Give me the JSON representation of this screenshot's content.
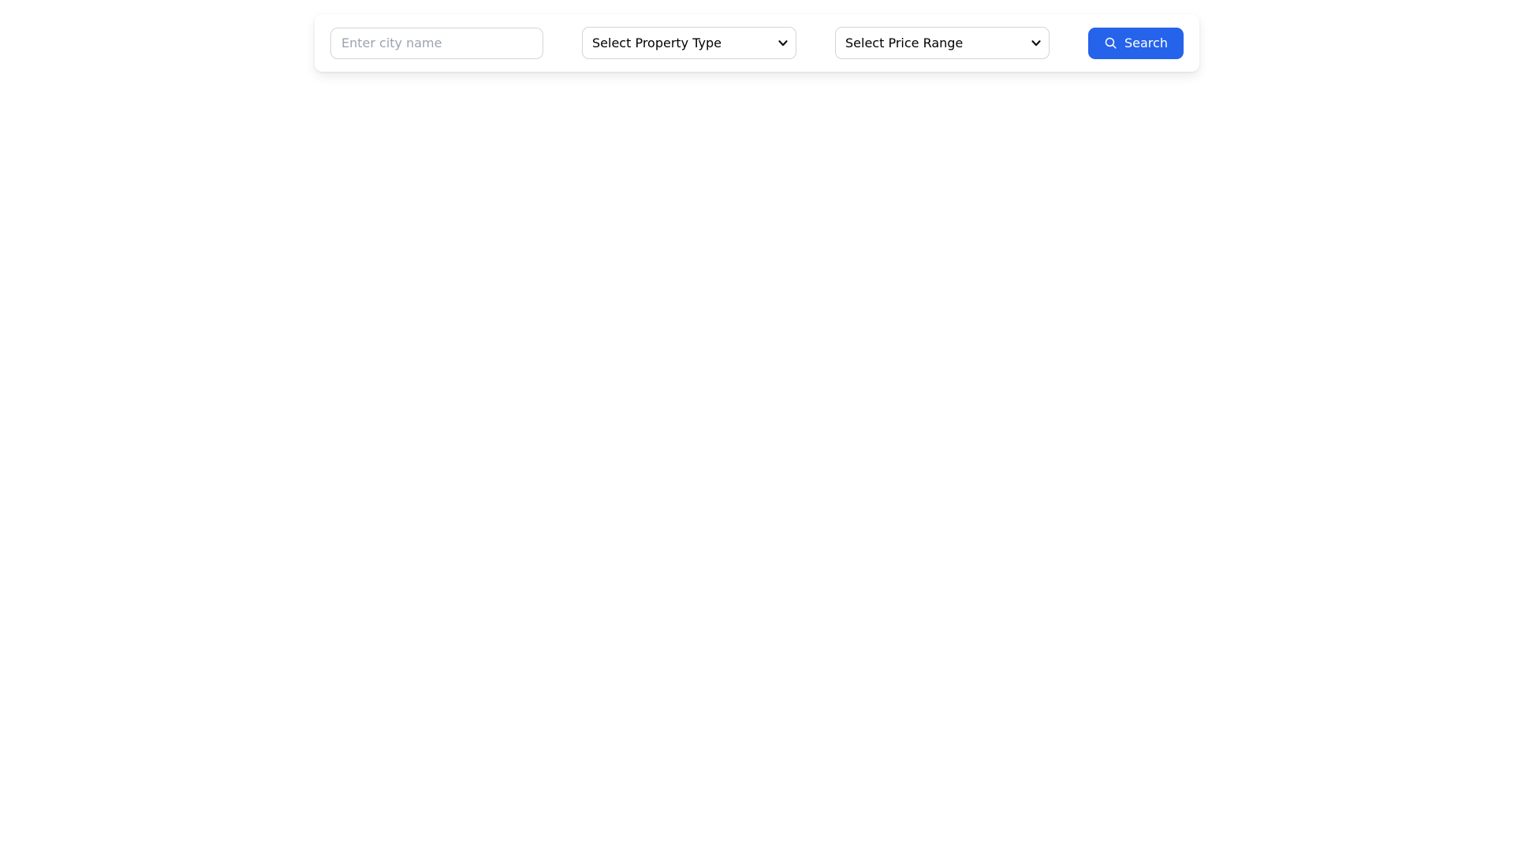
{
  "search_bar": {
    "city_input": {
      "placeholder": "Enter city name",
      "value": ""
    },
    "property_type_select": {
      "selected_option": "Select Property Type"
    },
    "price_range_select": {
      "selected_option": "Select Price Range"
    },
    "search_button": {
      "label": "Search",
      "icon": "search-icon"
    }
  },
  "colors": {
    "page_background": "#ffffff",
    "card_background": "#ffffff",
    "accent_button": "#2563eb",
    "button_text": "#ffffff",
    "input_border": "#d1d5db",
    "placeholder_text": "#9ca3af",
    "select_text": "#000000"
  }
}
